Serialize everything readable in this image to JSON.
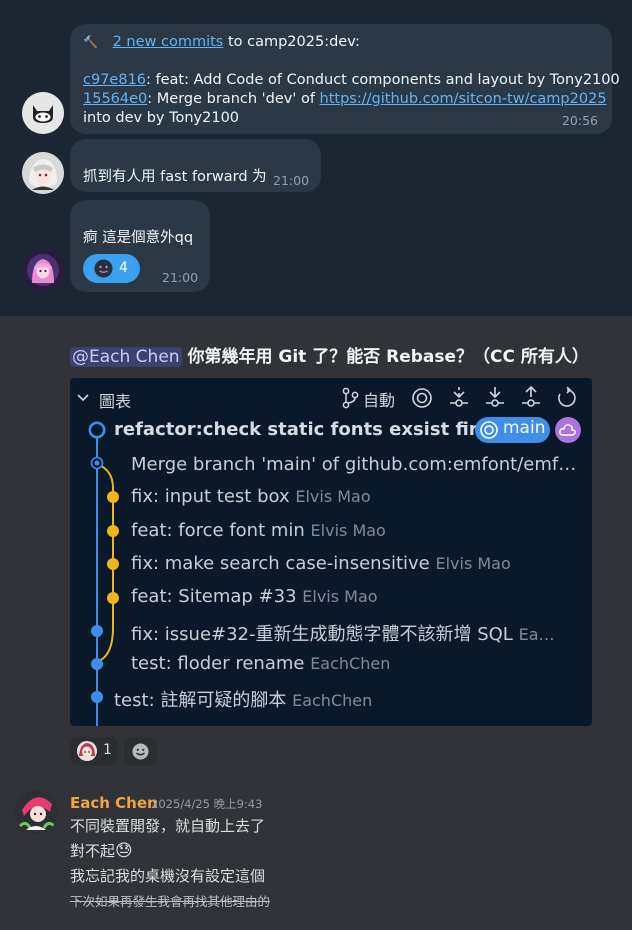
{
  "telegram": {
    "msg1": {
      "emoji": "🔨",
      "commits_link": "2 new commits",
      "to_text": " to camp2025:dev:",
      "commit1_hash": "c97e816",
      "commit1_text": ": feat: Add Code of Conduct components and layout by Tony2100",
      "commit2_hash": "15564e0",
      "commit2_text": ": Merge branch 'dev' of ",
      "commit2_url": "https://github.com/sitcon-tw/camp2025",
      "commit2_tail": "into dev by Tony2100",
      "time": "20:56"
    },
    "msg2": {
      "text": "抓到有人用 fast forward 为",
      "time": "21:00"
    },
    "msg3": {
      "text": "痾 這是個意外qq",
      "reaction_count": "4",
      "time": "21:00"
    }
  },
  "discord": {
    "title_mention": "@Each Chen",
    "title_text": " 你第幾年用 Git 了？能否 Rebase？（CC 所有人）",
    "git_panel": {
      "header_label": "圖表",
      "auto_label": "自動",
      "commits": [
        {
          "message": "refactor:check static fonts exsist fir…",
          "author": ""
        },
        {
          "message": "Merge branch 'main' of github.com:emfont/emf…",
          "author": ""
        },
        {
          "message": "fix: input test box",
          "author": "Elvis Mao"
        },
        {
          "message": "feat: force font min",
          "author": "Elvis Mao"
        },
        {
          "message": "fix: make search case-insensitive",
          "author": "Elvis Mao"
        },
        {
          "message": "feat: Sitemap #33",
          "author": "Elvis Mao"
        },
        {
          "message": "fix: issue#32-重新生成動態字體不該新增 SQL",
          "author": "Ea…"
        },
        {
          "message": "test: floder rename",
          "author": "EachChen"
        },
        {
          "message": "test: 註解可疑的腳本",
          "author": "EachChen"
        }
      ],
      "branch_badge": "main"
    },
    "reaction_count": "1",
    "reply": {
      "author": "Each Chen",
      "author_color": "#f0a445",
      "timestamp": "2025/4/25 晚上9:43",
      "lines": [
        "不同裝置開發，就自動上去了",
        "對不起",
        "我忘記我的桌機沒有設定這個",
        "下次如果再發生我會再找其他理由的"
      ],
      "line2_emoji": "😓"
    }
  }
}
